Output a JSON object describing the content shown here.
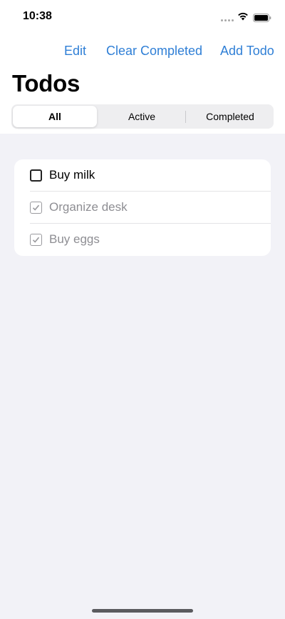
{
  "status": {
    "time": "10:38"
  },
  "nav": {
    "edit": "Edit",
    "clear_completed": "Clear Completed",
    "add_todo": "Add Todo"
  },
  "title": "Todos",
  "filters": {
    "all": "All",
    "active": "Active",
    "completed": "Completed",
    "selected": "All"
  },
  "todos": [
    {
      "label": "Buy milk",
      "completed": false
    },
    {
      "label": "Organize desk",
      "completed": true
    },
    {
      "label": "Buy eggs",
      "completed": true
    }
  ],
  "colors": {
    "accent": "#2f7fd6",
    "completed_text": "#8e8e93",
    "background": "#f2f2f7"
  }
}
